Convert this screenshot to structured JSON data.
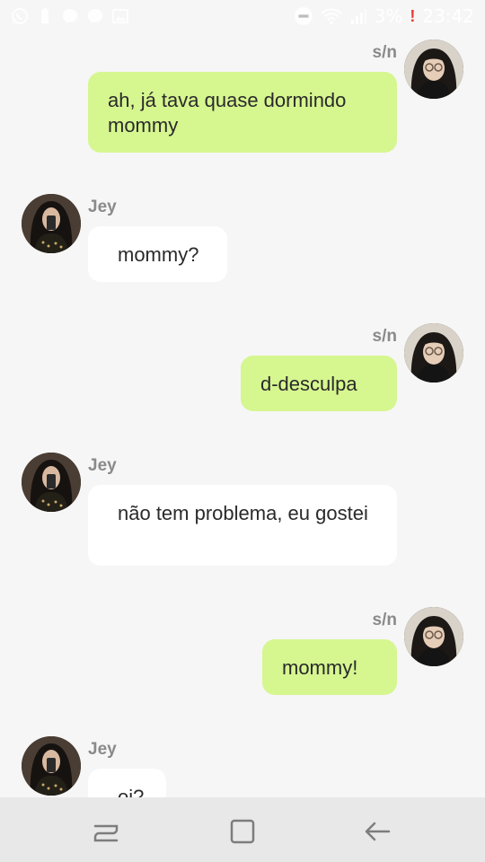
{
  "status_bar": {
    "left_icons": [
      "whatsapp-icon",
      "battery-saver-icon",
      "messenger-icon",
      "messenger-icon",
      "gallery-icon"
    ],
    "right_icons": [
      "do-not-disturb-icon",
      "wifi-icon",
      "signal-icon"
    ],
    "battery": "3%",
    "alert": "!",
    "time": "23:42"
  },
  "messages": [
    {
      "sender": "s/n",
      "direction": "out",
      "text": "ah, já tava quase dormindo mommy"
    },
    {
      "sender": "Jey",
      "direction": "in",
      "text": "mommy?"
    },
    {
      "sender": "s/n",
      "direction": "out",
      "text": "d-desculpa"
    },
    {
      "sender": "Jey",
      "direction": "in",
      "text": "não tem problema, eu gostei"
    },
    {
      "sender": "s/n",
      "direction": "out",
      "text": "mommy!"
    },
    {
      "sender": "Jey",
      "direction": "in",
      "text": "oi?"
    }
  ],
  "nav_bar": {
    "buttons": [
      "recents-icon",
      "home-icon",
      "back-icon"
    ]
  },
  "colors": {
    "background": "#f6f6f6",
    "outgoing_bubble": "#d6f690",
    "incoming_bubble": "#ffffff",
    "name_text": "#8a8a8a",
    "nav_background": "#e8e8e8"
  }
}
